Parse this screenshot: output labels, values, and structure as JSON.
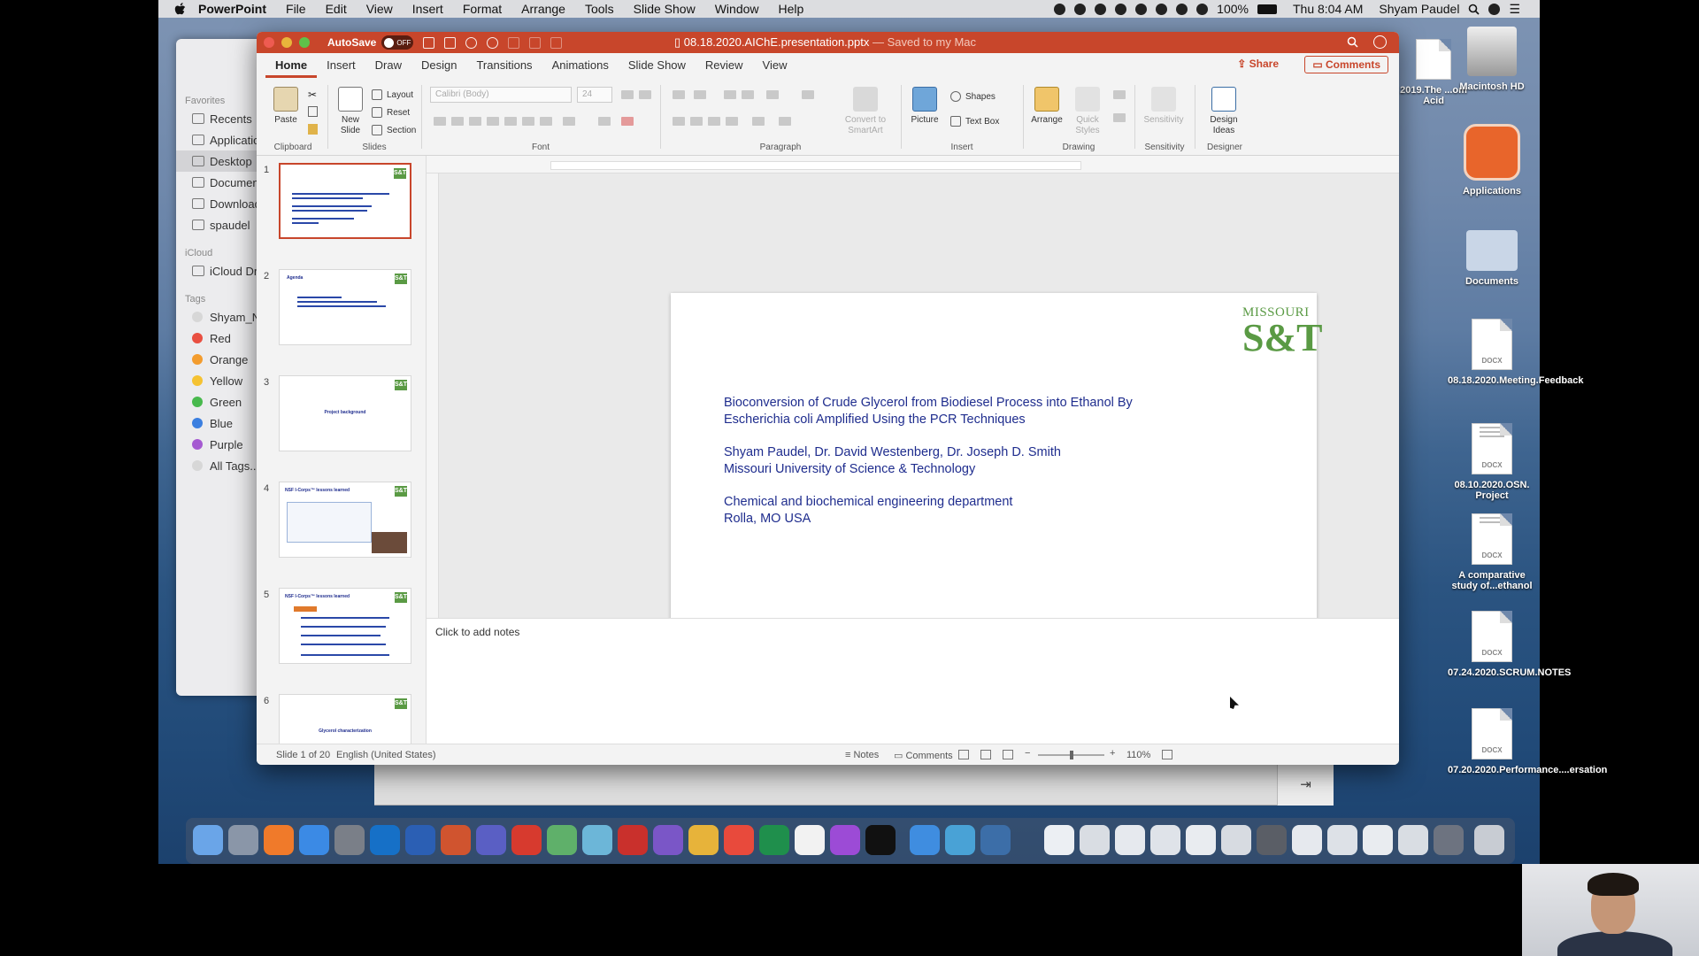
{
  "menubar": {
    "app": "PowerPoint",
    "items": [
      "File",
      "Edit",
      "View",
      "Insert",
      "Format",
      "Arrange",
      "Tools",
      "Slide Show",
      "Window",
      "Help"
    ],
    "battery": "100%",
    "clock": "Thu 8:04 AM",
    "user": "Shyam Paudel"
  },
  "finder": {
    "favorites_header": "Favorites",
    "favorites": [
      "Recents",
      "Applicatio",
      "Desktop",
      "Documen",
      "Downloads",
      "spaudel"
    ],
    "icloud_header": "iCloud",
    "icloud": [
      "iCloud Dr"
    ],
    "tags_header": "Tags",
    "tags": [
      {
        "label": "Shyam_N",
        "color": "#d7d7d7"
      },
      {
        "label": "Red",
        "color": "#e94f41"
      },
      {
        "label": "Orange",
        "color": "#f39c2e"
      },
      {
        "label": "Yellow",
        "color": "#f5c232"
      },
      {
        "label": "Green",
        "color": "#48b94d"
      },
      {
        "label": "Blue",
        "color": "#3b7fe0"
      },
      {
        "label": "Purple",
        "color": "#a55ad1"
      },
      {
        "label": "All Tags...",
        "color": "#d7d7d7"
      }
    ]
  },
  "window": {
    "autosave": "AutoSave",
    "toggle": "OFF",
    "filename": "08.18.2020.AIChE.presentation.pptx",
    "saved": "— Saved to my Mac"
  },
  "tabs": [
    "Home",
    "Insert",
    "Draw",
    "Design",
    "Transitions",
    "Animations",
    "Slide Show",
    "Review",
    "View"
  ],
  "share": "Share",
  "comments_btn": "Comments",
  "ribbon": {
    "clipboard": {
      "paste": "Paste",
      "label": "Clipboard"
    },
    "slides": {
      "new_slide": "New Slide",
      "layout": "Layout",
      "reset": "Reset",
      "section": "Section",
      "label": "Slides"
    },
    "font": {
      "name": "Calibri (Body)",
      "size": "24",
      "label": "Font"
    },
    "paragraph": {
      "smartart": "Convert to SmartArt",
      "label": "Paragraph"
    },
    "insert": {
      "picture": "Picture",
      "shapes": "Shapes",
      "textbox": "Text Box",
      "label": "Insert"
    },
    "drawing": {
      "arrange": "Arrange",
      "quick": "Quick Styles",
      "label": "Drawing"
    },
    "sensitivity": {
      "btn": "Sensitivity",
      "label": "Sensitivity"
    },
    "designer": {
      "btn": "Design Ideas",
      "label": "Designer"
    }
  },
  "thumbs": [
    {
      "num": "1",
      "title": ""
    },
    {
      "num": "2",
      "title": "Agenda"
    },
    {
      "num": "3",
      "title": "Project background"
    },
    {
      "num": "4",
      "title": "NSF I-Corps™ lessons learned"
    },
    {
      "num": "5",
      "title": "NSF I-Corps™ lessons learned"
    },
    {
      "num": "6",
      "title": "Glycerol characterization"
    }
  ],
  "slide": {
    "logo_top": "MISSOURI",
    "logo_big": "S&T",
    "title_l1": "Bioconversion of Crude Glycerol from Biodiesel Process into Ethanol By",
    "title_l2": "Escherichia coli Amplified Using the PCR Techniques",
    "authors": "Shyam Paudel, Dr. David Westenberg, Dr. Joseph D. Smith",
    "univ": "Missouri University of Science & Technology",
    "dept": "Chemical and biochemical engineering department",
    "city": "Rolla, MO USA"
  },
  "notes_placeholder": "Click to add notes",
  "status": {
    "slide": "Slide 1 of 20",
    "lang": "English (United States)",
    "notes": "Notes",
    "comments": "Comments",
    "zoom": "110%"
  },
  "desktop_icons": [
    {
      "label": "2019.The ...om Acid"
    },
    {
      "label": "Macintosh HD"
    },
    {
      "label": "Applications"
    },
    {
      "label": "Documents"
    },
    {
      "label": "08.18.2020.Meeting.Feedback"
    },
    {
      "label": "08.10.2020.OSN. Project"
    },
    {
      "label": "A comparative study of...ethanol"
    },
    {
      "label": "07.24.2020.SCRUM.NOTES"
    },
    {
      "label": "07.20.2020.Performance....ersation"
    }
  ]
}
